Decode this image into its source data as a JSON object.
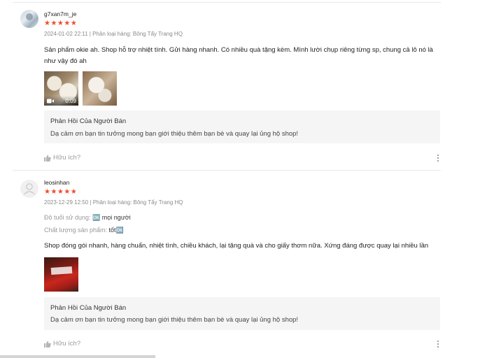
{
  "rating_color": "#ee4d2d",
  "reviews": [
    {
      "username": "g7xan7m_je",
      "stars": "★★★★★",
      "meta": "2024-01-02 22:11 | Phân loại hàng: Bông Tẩy Trang HQ",
      "text": "Sản phẩm okie ah. Shop hỗ trợ nhiệt tình. Gửi hàng nhanh. Có nhiều quà tặng kèm. Mình lười chụp riêng từng sp, chung cả lô nó là như vậy đó ah",
      "video_duration": "0:09",
      "reply_title": "Phản Hồi Của Người Bán",
      "reply_text": "Dạ cảm ơn bạn tin tưởng mong bạn giới thiệu thêm bạn bè và quay lại ủng hộ shop!",
      "helpful_label": "Hữu ích?"
    },
    {
      "username": "leosinhan",
      "stars": "★★★★★",
      "meta": "2023-12-29 12:50 | Phân loại hàng: Bông Tẩy Trang HQ",
      "attr1_label": "Độ tuổi sử dụng:",
      "attr1_value": "🆗 mọi người",
      "attr2_label": "Chất lượng sản phẩm:",
      "attr2_value": "tốt🆗",
      "text": "Shop đóng gói nhanh, hàng chuẩn, nhiệt tình, chiều khách, lại tặng quà và cho giấy thơm nữa. Xứng đáng được quay lại nhiều lần",
      "reply_title": "Phản Hồi Của Người Bán",
      "reply_text": "Dạ cảm ơn bạn tin tưởng mong bạn giới thiệu thêm bạn bè và quay lại ủng hộ shop!",
      "helpful_label": "Hữu ích?"
    }
  ]
}
